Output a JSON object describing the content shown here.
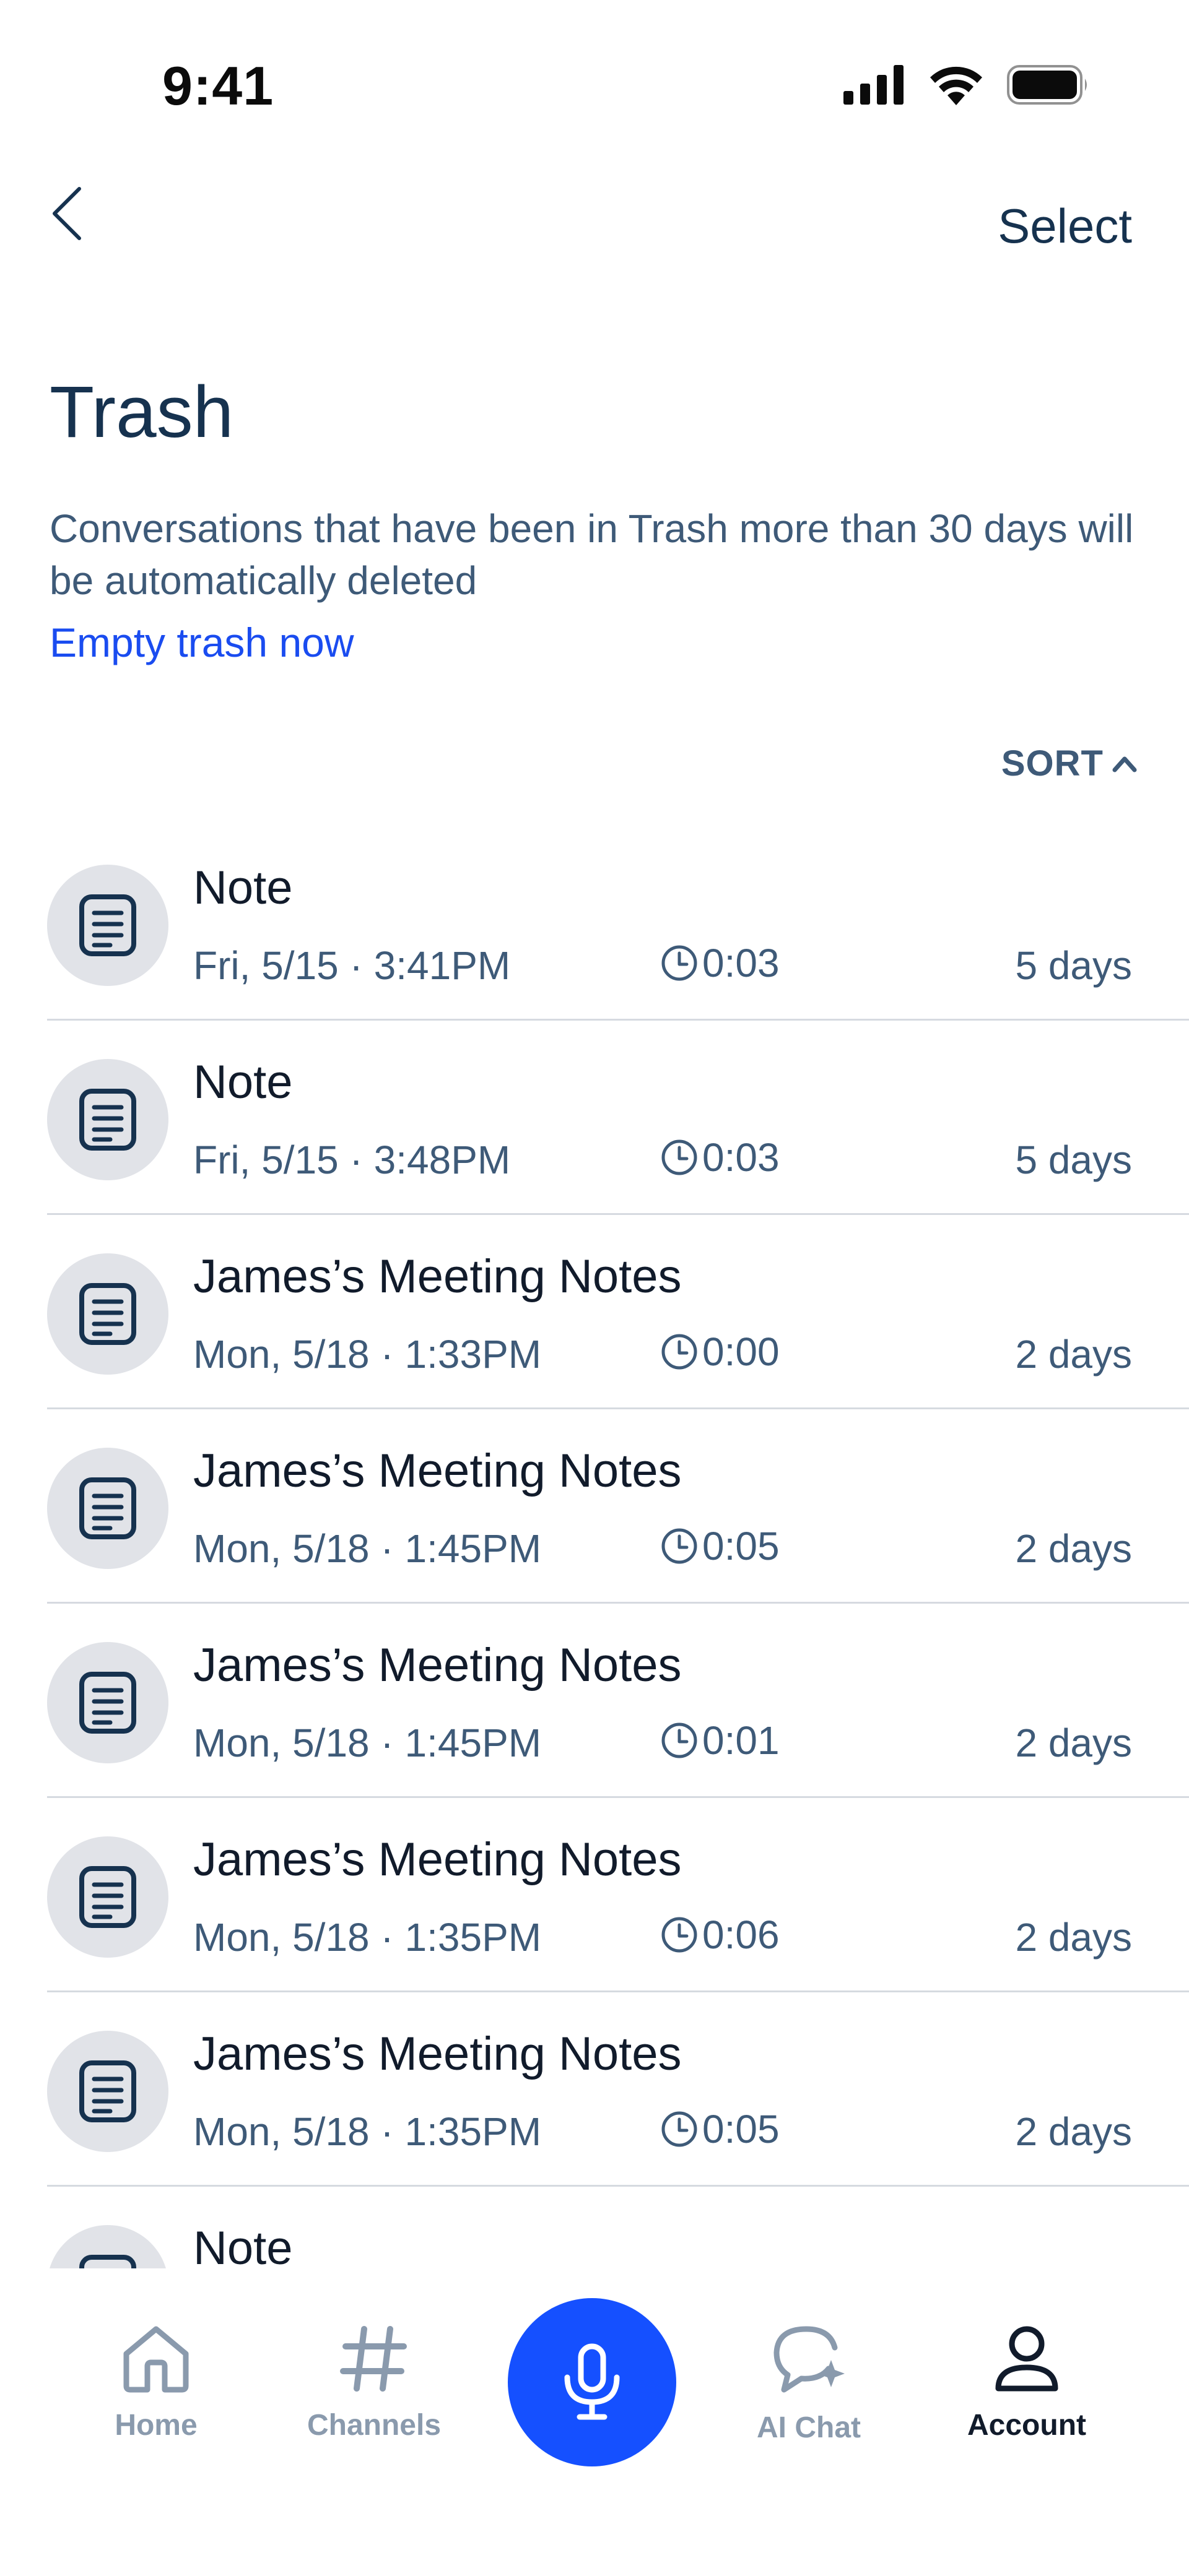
{
  "status_bar": {
    "time": "9:41"
  },
  "nav": {
    "select_label": "Select"
  },
  "header": {
    "title": "Trash",
    "description": "Conversations that have been in Trash more than 30 days will be automatically deleted",
    "empty_trash_label": "Empty trash now"
  },
  "sort": {
    "label": "SORT"
  },
  "items": [
    {
      "title": "Note",
      "date": "Fri, 5/15 · 3:41PM",
      "duration": "0:03",
      "days": "5 days"
    },
    {
      "title": "Note",
      "date": "Fri, 5/15 · 3:48PM",
      "duration": "0:03",
      "days": "5 days"
    },
    {
      "title": "James’s Meeting Notes",
      "date": "Mon, 5/18 · 1:33PM",
      "duration": "0:00",
      "days": "2 days"
    },
    {
      "title": "James’s Meeting Notes",
      "date": "Mon, 5/18 · 1:45PM",
      "duration": "0:05",
      "days": "2 days"
    },
    {
      "title": "James’s Meeting Notes",
      "date": "Mon, 5/18 · 1:45PM",
      "duration": "0:01",
      "days": "2 days"
    },
    {
      "title": "James’s Meeting Notes",
      "date": "Mon, 5/18 · 1:35PM",
      "duration": "0:06",
      "days": "2 days"
    },
    {
      "title": "James’s Meeting Notes",
      "date": "Mon, 5/18 · 1:35PM",
      "duration": "0:05",
      "days": "2 days"
    },
    {
      "title": "Note"
    }
  ],
  "tabs": {
    "home": "Home",
    "channels": "Channels",
    "ai_chat": "AI Chat",
    "account": "Account"
  },
  "icons": {
    "back": "chevron-left-icon",
    "sort": "chevron-up-icon",
    "item": "document-icon",
    "duration": "clock-icon",
    "record": "microphone-icon"
  },
  "colors": {
    "accent": "#1550ff",
    "link": "#1a4cf0",
    "title": "#16324f",
    "secondary": "#3e5a78",
    "avatar_bg": "#e1e3e8",
    "tab_inactive": "#8a9aad"
  }
}
